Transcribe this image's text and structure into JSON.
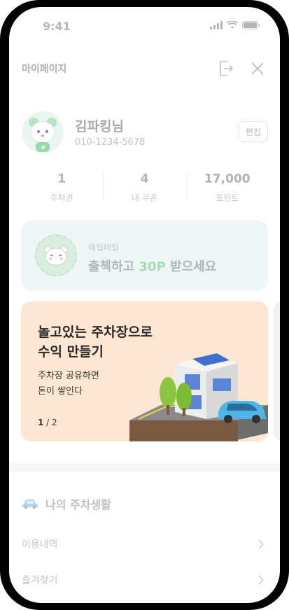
{
  "status": {
    "time": "9:41"
  },
  "header": {
    "title": "마이페이지"
  },
  "profile": {
    "name": "김파킹님",
    "phone": "010-1234-5678",
    "edit_label": "편집"
  },
  "stats": [
    {
      "value": "1",
      "label": "주차권"
    },
    {
      "value": "4",
      "label": "내 쿠폰"
    },
    {
      "value": "17,000",
      "label": "포인트"
    }
  ],
  "attendance": {
    "subtitle": "매일매일",
    "title_prefix": "출첵하고 ",
    "title_highlight": "30P",
    "title_suffix": " 받으세요"
  },
  "banner": {
    "title_line1": "놀고있는 주차장으로",
    "title_line2": "수익 만들기",
    "desc_line1": "주차장 공유하면",
    "desc_line2": "돈이 쌓인다",
    "page_current": "1",
    "page_total": " / 2"
  },
  "my_parking": {
    "title": "나의 주차생활",
    "items": [
      {
        "label": "이용내역"
      },
      {
        "label": "즐겨찾기"
      }
    ]
  },
  "colors": {
    "accent_green": "#a6dcb4",
    "banner_bg": "#fde7d2",
    "attend_bg": "#eef7f6"
  }
}
